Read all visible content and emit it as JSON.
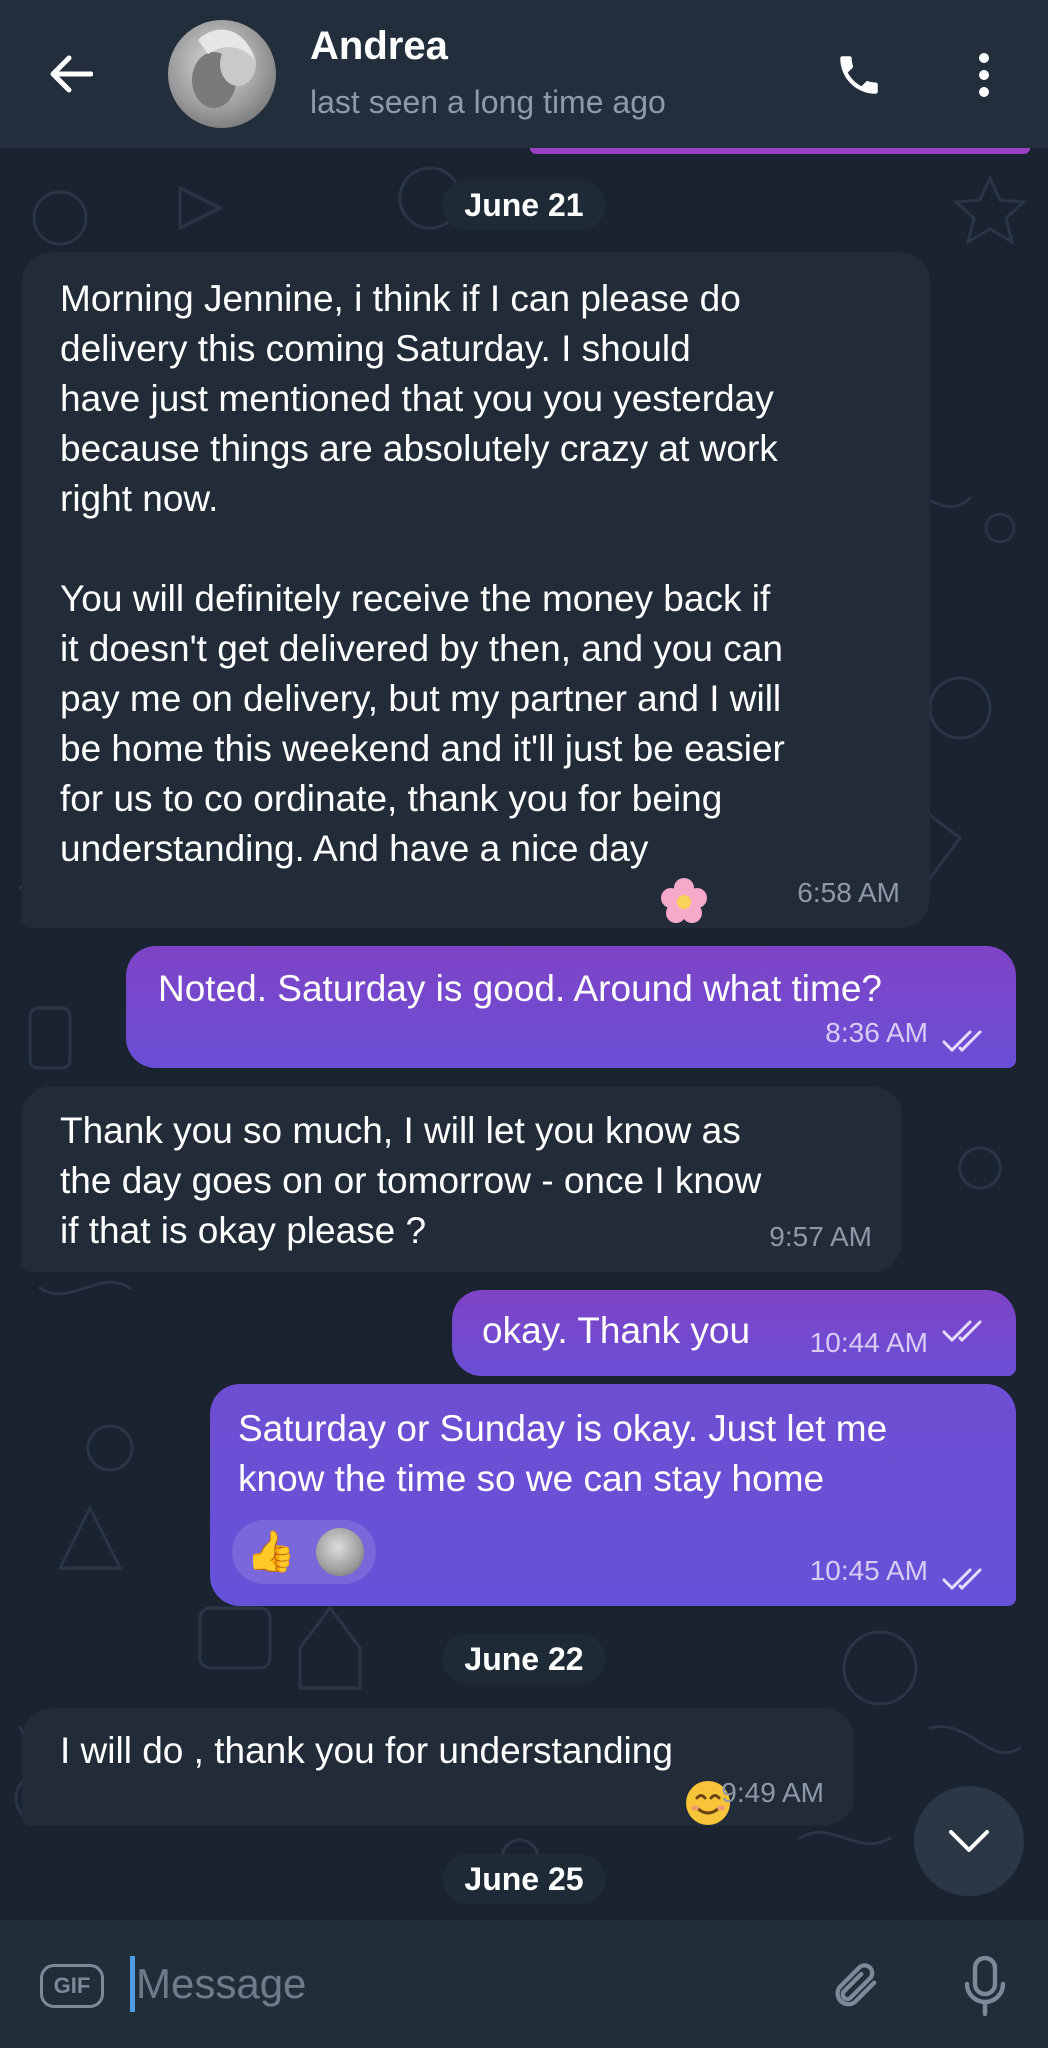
{
  "header": {
    "title": "Andrea",
    "subtitle": "last seen a long time ago"
  },
  "dates": [
    "June 21",
    "June 22",
    "June 25"
  ],
  "messages": [
    {
      "direction": "incoming",
      "text": "Morning Jennine, i think if I can please do\ndelivery this coming Saturday. I should\nhave just mentioned that you you yesterday\nbecause things are absolutely crazy at work\nright now.\n\nYou will definitely receive the money back if\nit doesn't get delivered by then, and you can\npay me on delivery, but my partner and I will\nbe home this weekend and it'll just be easier\nfor us to co ordinate, thank you for being\nunderstanding. And have a nice day",
      "emoji": "flower-emoji",
      "time": "6:58 AM"
    },
    {
      "direction": "outgoing",
      "text": "Noted. Saturday is good. Around what time?",
      "time": "8:36 AM",
      "read": true
    },
    {
      "direction": "incoming",
      "text": "Thank you so much, I will let you know as\nthe day goes on or tomorrow - once I know\nif that is okay please ?",
      "time": "9:57 AM"
    },
    {
      "direction": "outgoing",
      "text": "okay. Thank you",
      "time": "10:44 AM",
      "read": true
    },
    {
      "direction": "outgoing",
      "text": "Saturday or Sunday is okay. Just let me\nknow the time so we can stay home",
      "reaction": "👍",
      "time": "10:45 AM",
      "read": true
    },
    {
      "direction": "incoming",
      "text": "I will do , thank you for understanding",
      "emoji": "smiling-face-emoji",
      "time": "9:49 AM"
    }
  ],
  "input": {
    "gif_label": "GIF",
    "placeholder": "Message"
  },
  "colors": {
    "background": "#1a2431",
    "header": "#232e3c",
    "incoming_bubble": "#222c39",
    "outgoing_bubble": "#7f43c6",
    "accent": "#4d9ae6"
  }
}
